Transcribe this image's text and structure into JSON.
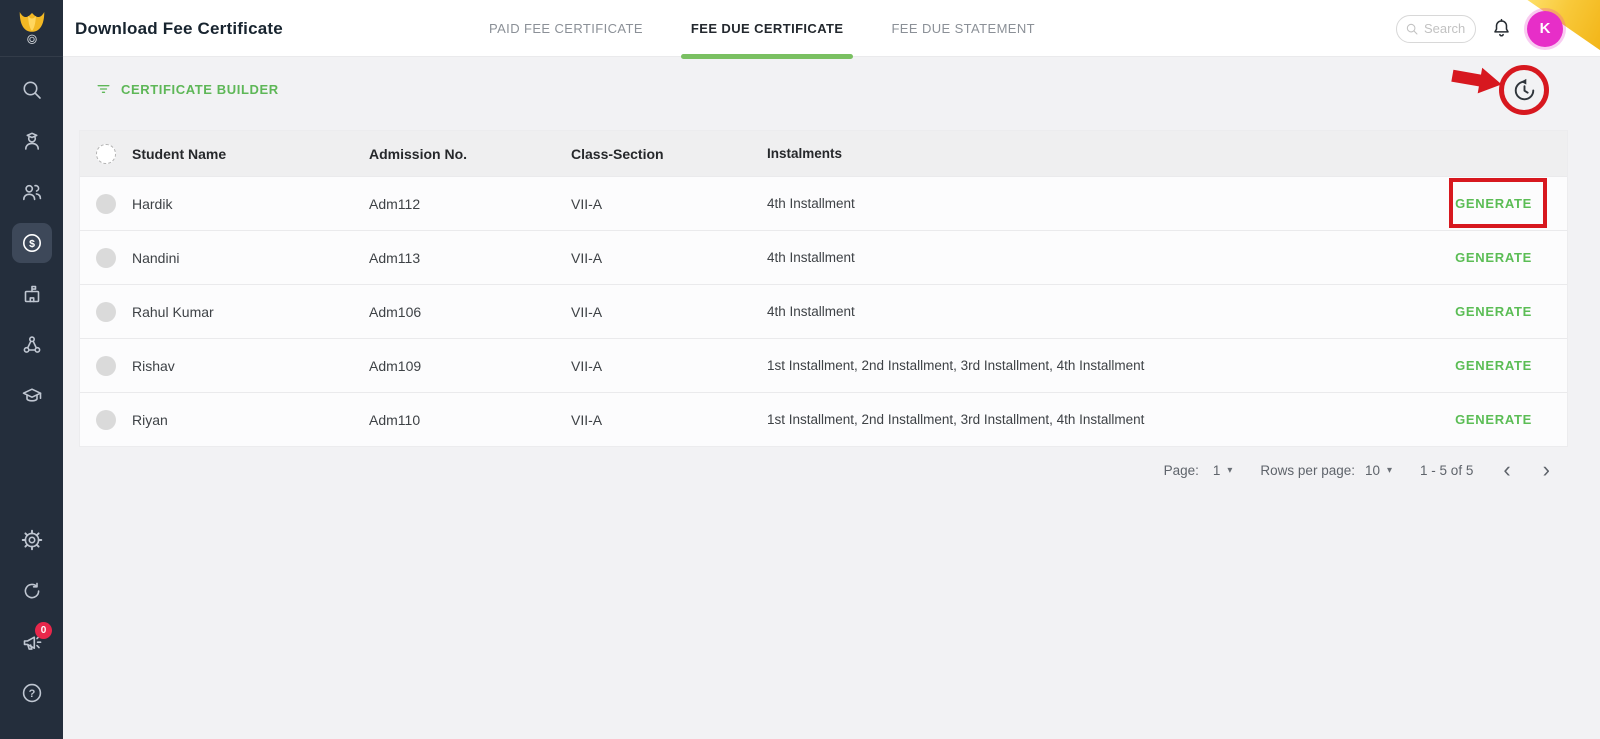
{
  "app": {
    "title": "Download Fee Certificate",
    "search_placeholder": "Search",
    "avatar_letter": "K"
  },
  "tabs": [
    {
      "label": "PAID FEE CERTIFICATE",
      "active": false
    },
    {
      "label": "FEE DUE CERTIFICATE",
      "active": true
    },
    {
      "label": "FEE DUE STATEMENT",
      "active": false
    }
  ],
  "toolbar": {
    "certificate_builder_label": "CERTIFICATE BUILDER"
  },
  "table": {
    "headers": [
      "Student Name",
      "Admission No.",
      "Class-Section",
      "Instalments"
    ],
    "action_label": "GENERATE",
    "rows": [
      {
        "student_name": "Hardik",
        "admission_no": "Adm112",
        "class_section": "VII-A",
        "instalments": "4th Installment"
      },
      {
        "student_name": "Nandini",
        "admission_no": "Adm113",
        "class_section": "VII-A",
        "instalments": "4th Installment"
      },
      {
        "student_name": "Rahul Kumar",
        "admission_no": "Adm106",
        "class_section": "VII-A",
        "instalments": "4th Installment"
      },
      {
        "student_name": "Rishav",
        "admission_no": "Adm109",
        "class_section": "VII-A",
        "instalments": "1st Installment, 2nd Installment, 3rd Installment, 4th Installment"
      },
      {
        "student_name": "Riyan",
        "admission_no": "Adm110",
        "class_section": "VII-A",
        "instalments": "1st Installment, 2nd Installment, 3rd Installment, 4th Installment"
      }
    ]
  },
  "pagination": {
    "page_label": "Page:",
    "page_value": "1",
    "rows_per_page_label": "Rows per page:",
    "rows_per_page_value": "10",
    "range_text": "1 - 5 of 5"
  },
  "sidebar": {
    "announcement_badge": "0",
    "items": [
      {
        "icon": "search-icon"
      },
      {
        "icon": "student-icon"
      },
      {
        "icon": "people-icon"
      },
      {
        "icon": "fees-icon",
        "active": true
      },
      {
        "icon": "school-icon"
      },
      {
        "icon": "community-icon"
      },
      {
        "icon": "academics-icon"
      }
    ],
    "bottom_items": [
      {
        "icon": "settings-icon"
      },
      {
        "icon": "sync-icon"
      },
      {
        "icon": "announcements-icon",
        "badge": "0"
      },
      {
        "icon": "help-icon"
      }
    ]
  },
  "icons": {
    "caret_down": "▾",
    "chevron_left": "‹",
    "chevron_right": "›"
  },
  "colors": {
    "accent_green": "#5EB757",
    "tab_underline_green": "#7AC062",
    "sidebar_bg": "#242E3C",
    "annotation_red": "#D7181F",
    "avatar_magenta": "#E72EC8",
    "corner_yellow": "#F5C42C"
  }
}
